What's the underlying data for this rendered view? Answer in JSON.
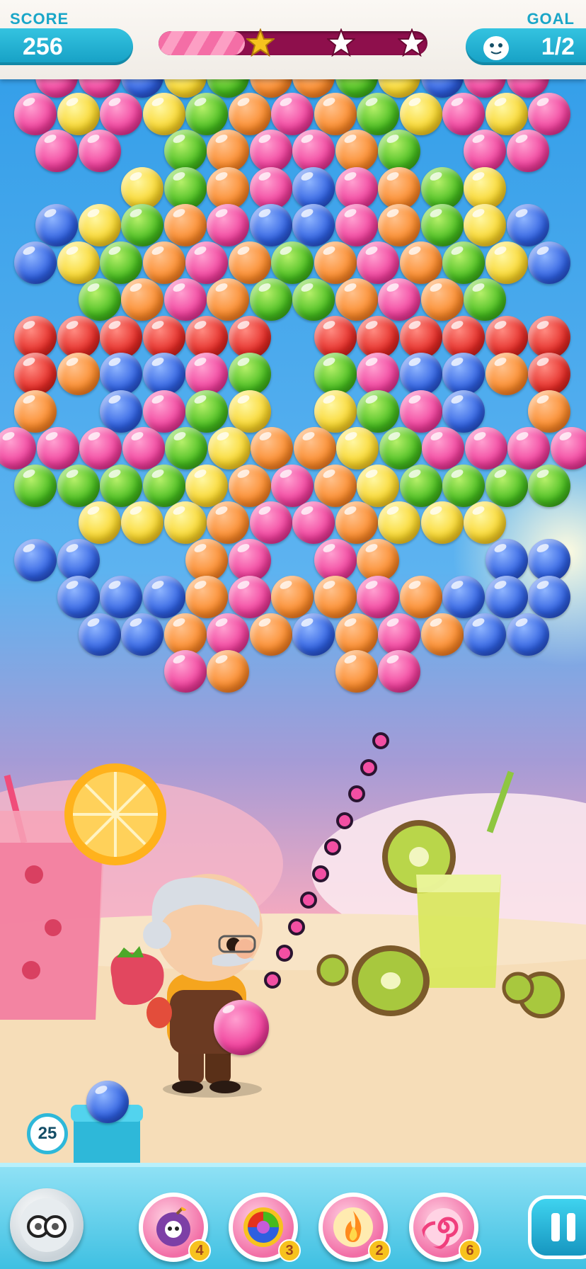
{
  "hud": {
    "score_label": "SCORE",
    "score_value": "256",
    "goal_label": "GOAL",
    "goal_value": "1/2",
    "goal_icon": "ghost-icon",
    "progress_fraction": 0.32,
    "stars_earned": 1,
    "stars_total": 3
  },
  "board": {
    "rows": [
      "p p b y g o o g y b p p",
      "p y p y g o p o g y p y p",
      "p p . g o p p o g . p p",
      ". . y g o p b p o g y .",
      "b y g o p b b p o g y b",
      "b y g o p o g o p o g y b",
      ". g o p o g g o p o g .",
      "r r r r r r . r r r r r r",
      "r o b b p g . g p b b o r",
      "o . b p g y . y g p b . o",
      "p p p p g y o o y g p p p p",
      "g g g g y o p o y g g g g",
      ". y y y o p p o y y y .",
      "b b . . o p . p o . . b b",
      ". b b b o p o o p o b b b",
      ". b b o p o b o p o b b",
      ". . . p o . . o p . . ."
    ],
    "legend": {
      "p": "pink",
      "y": "yellow",
      "g": "green",
      "o": "orange",
      "b": "blue",
      "r": "red"
    }
  },
  "launcher": {
    "bubbles_left": "25",
    "next_bubble_color": "blue",
    "current_bubble_color": "pink"
  },
  "boosters": [
    {
      "name": "bomb",
      "icon": "skull-bomb-icon",
      "count": "4"
    },
    {
      "name": "rainbow",
      "icon": "rainbow-swirl-icon",
      "count": "3"
    },
    {
      "name": "fireball",
      "icon": "fire-icon",
      "count": "2"
    },
    {
      "name": "lollipop",
      "icon": "swirl-candy-icon",
      "count": "6"
    }
  ],
  "colors": {
    "hud_accent": "#1aa6c8",
    "progress_track": "#8e0f4c",
    "progress_fill": "#f46ea6",
    "aim_dot": "#f24fa3"
  }
}
